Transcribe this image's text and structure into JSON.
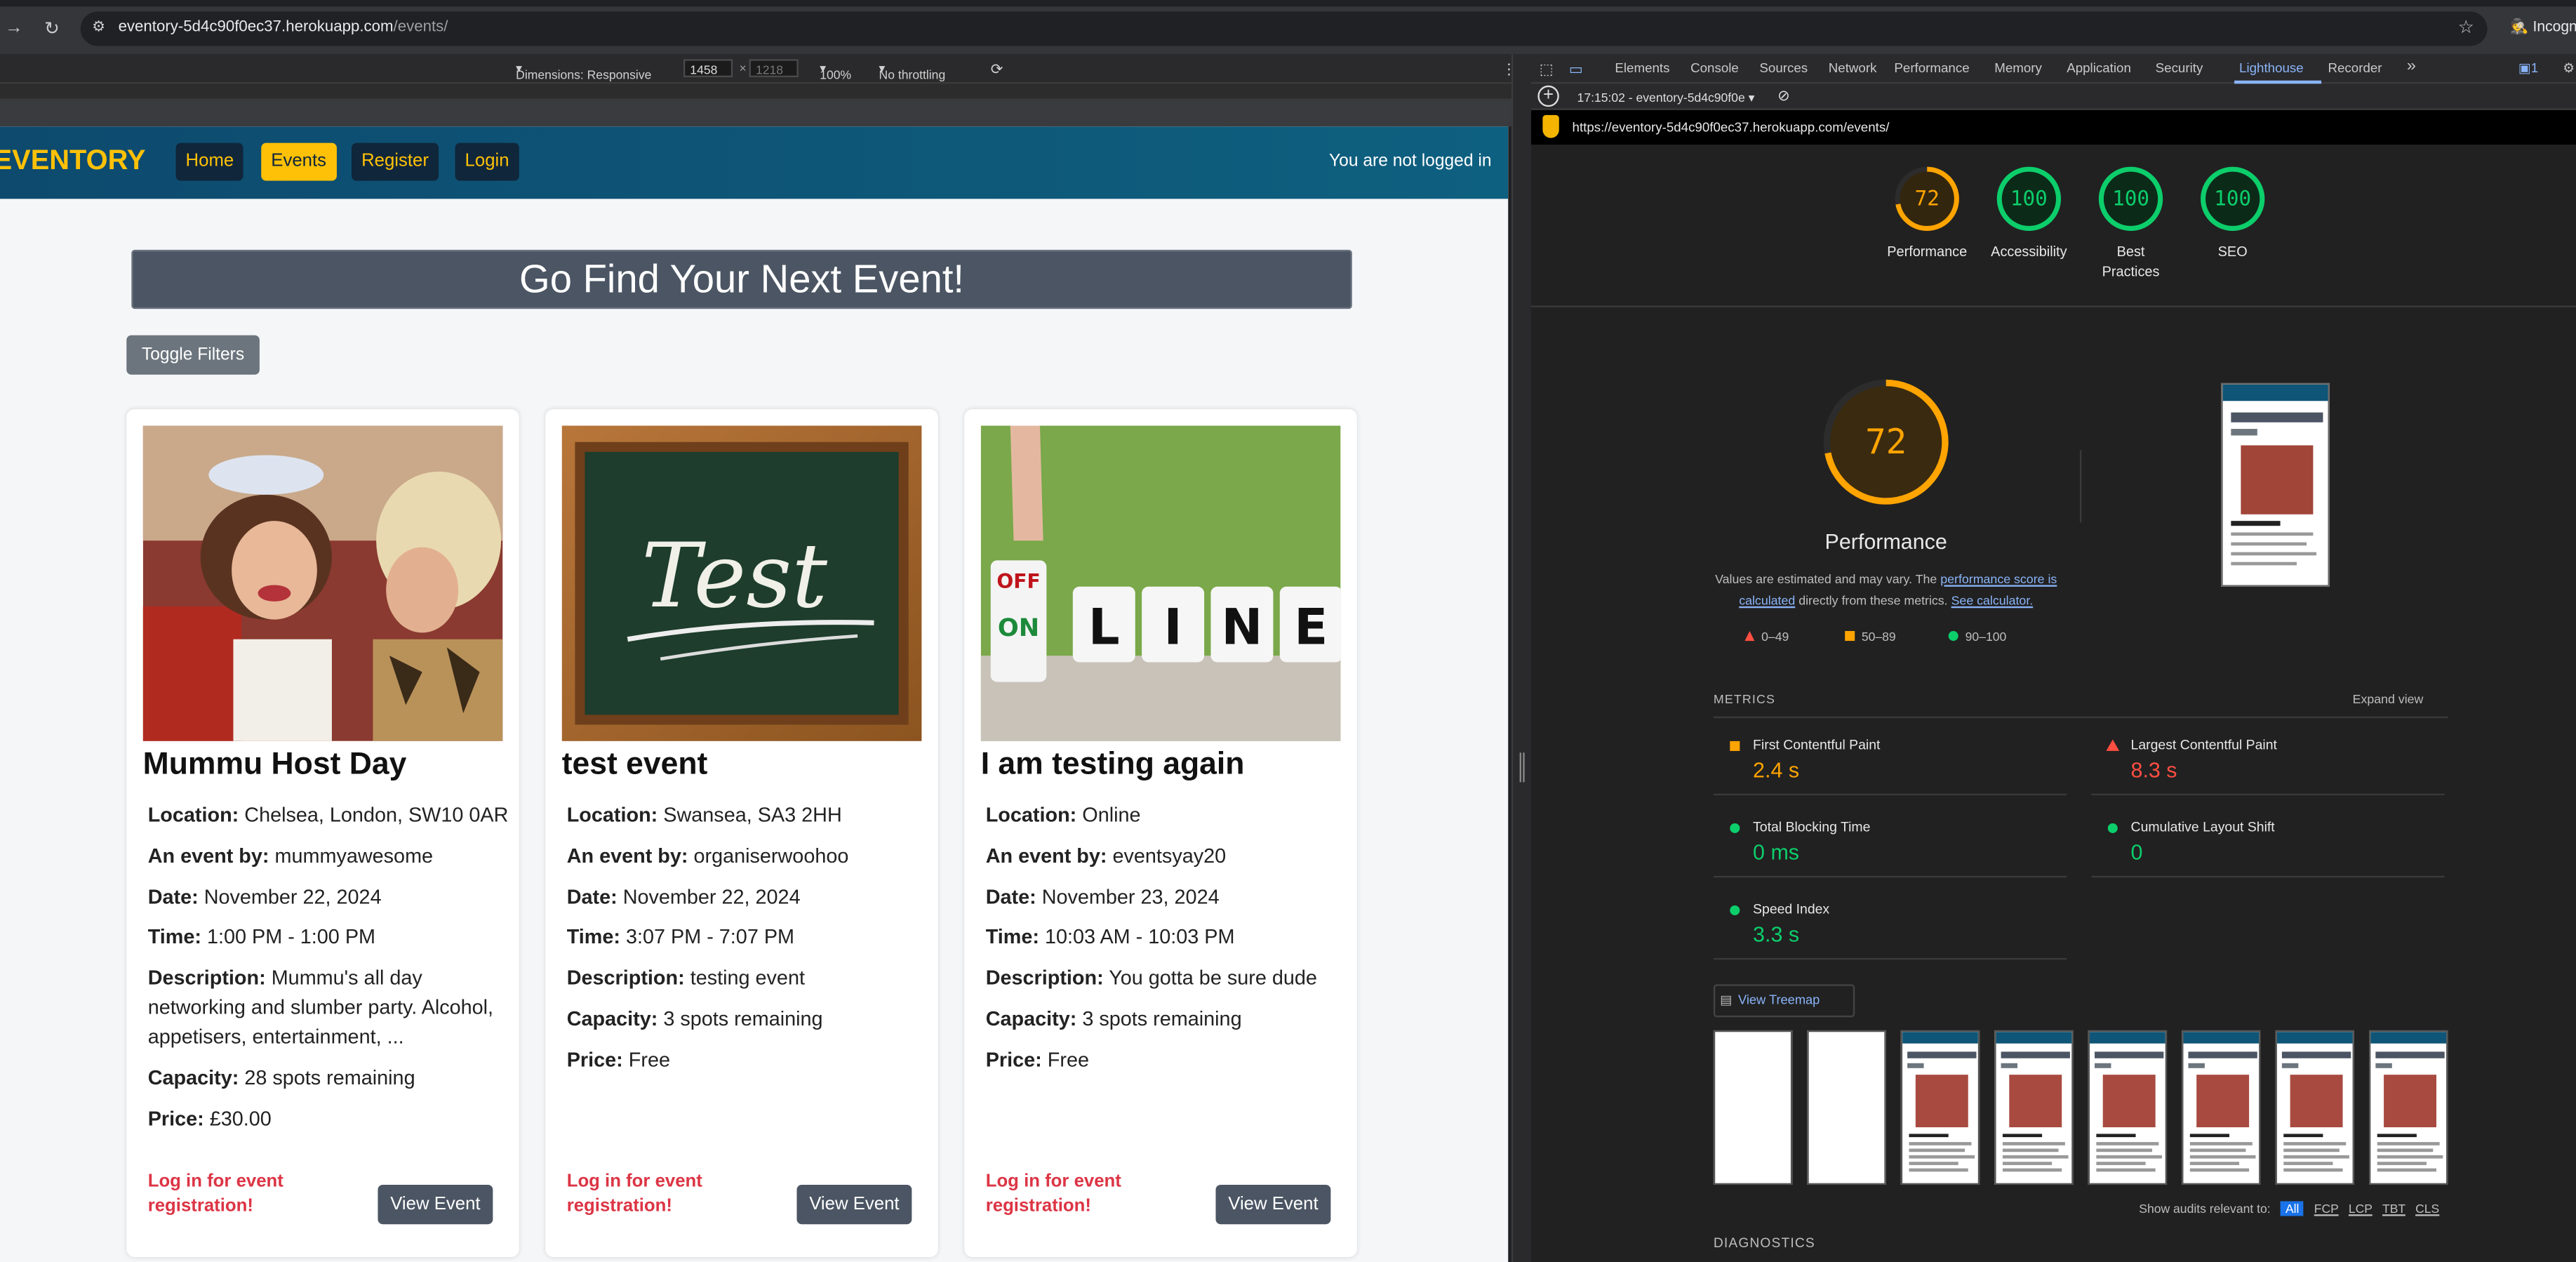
{
  "browser": {
    "url_domain": "eventory-5d4c90f0ec37.herokuapp.com",
    "url_path": "/events/",
    "incognito_label": "Incognito"
  },
  "device_toolbar": {
    "dimensions_label": "Dimensions: Responsive",
    "width": "1458",
    "height": "1218",
    "zoom": "100%",
    "throttling": "No throttling"
  },
  "site": {
    "brand": "EVENTORY",
    "nav": [
      "Home",
      "Events",
      "Register",
      "Login"
    ],
    "active_nav": "Events",
    "login_status": "You are not logged in",
    "hero_title": "Go Find Your Next Event!",
    "toggle_filters": "Toggle Filters",
    "cards": [
      {
        "title": "Mummu Host Day",
        "image": "party-photo",
        "location": "Chelsea, London, SW10 0AR",
        "organiser": "mummyawesome",
        "date": "November 22, 2024",
        "time": "1:00 PM - 1:00 PM",
        "description": "Mummu's all day networking and slumber party. Alcohol, appetisers, entertainment, ...",
        "capacity": "28 spots remaining",
        "price": "£30.00"
      },
      {
        "title": "test event",
        "image": "chalkboard-test",
        "location": "Swansea, SA3 2HH",
        "organiser": "organiserwoohoo",
        "date": "November 22, 2024",
        "time": "3:07 PM - 7:07 PM",
        "description": "testing event",
        "capacity": "3 spots remaining",
        "price": "Free"
      },
      {
        "title": "I am testing again",
        "image": "online-dice",
        "location": "Online",
        "organiser": "eventsyay20",
        "date": "November 23, 2024",
        "time": "10:03 AM - 10:03 PM",
        "description": "You gotta be sure dude",
        "capacity": "3 spots remaining",
        "price": "Free"
      }
    ],
    "labels": {
      "location": "Location:",
      "organiser": "An event by:",
      "date": "Date:",
      "time": "Time:",
      "description": "Description:",
      "capacity": "Capacity:",
      "price": "Price:"
    },
    "login_prompt": "Log in for event registration!",
    "view_event": "View Event",
    "dice_letters": [
      "L",
      "I",
      "N",
      "E"
    ],
    "dice_off": "OFF",
    "dice_on": "ON",
    "chalk_text": "Test"
  },
  "devtools": {
    "tabs": [
      "Elements",
      "Console",
      "Sources",
      "Network",
      "Performance",
      "Memory",
      "Application",
      "Security",
      "Lighthouse",
      "Recorder"
    ],
    "active_tab": "Lighthouse",
    "issues_count": "1",
    "report_selector": "17:15:02 - eventory-5d4c90f0e",
    "report_url": "https://eventory-5d4c90f0ec37.herokuapp.com/events/",
    "scores": [
      {
        "label": "Performance",
        "value": 72,
        "color": "#ffa400"
      },
      {
        "label": "Accessibility",
        "value": 100,
        "color": "#0cce6b"
      },
      {
        "label": "Best Practices",
        "value": 100,
        "color": "#0cce6b"
      },
      {
        "label": "SEO",
        "value": 100,
        "color": "#0cce6b"
      }
    ],
    "perf": {
      "value": "72",
      "title": "Performance",
      "note_a": "Values are estimated and may vary. The ",
      "note_link1": "performance score is calculated",
      "note_b": " directly from these metrics. ",
      "note_link2": "See calculator.",
      "legend": [
        "0–49",
        "50–89",
        "90–100"
      ]
    },
    "metrics_header": "METRICS",
    "expand_view": "Expand view",
    "metrics": [
      {
        "name": "First Contentful Paint",
        "value": "2.4 s",
        "status": "average"
      },
      {
        "name": "Largest Contentful Paint",
        "value": "8.3 s",
        "status": "fail"
      },
      {
        "name": "Total Blocking Time",
        "value": "0 ms",
        "status": "pass"
      },
      {
        "name": "Cumulative Layout Shift",
        "value": "0",
        "status": "pass"
      },
      {
        "name": "Speed Index",
        "value": "3.3 s",
        "status": "pass"
      }
    ],
    "view_treemap": "View Treemap",
    "show_audits": "Show audits relevant to:",
    "audit_filters": [
      "All",
      "FCP",
      "LCP",
      "TBT",
      "CLS"
    ],
    "diagnostics": "DIAGNOSTICS",
    "colors": {
      "pass": "#0cce6b",
      "average": "#ffa400",
      "fail": "#ff4e42"
    }
  }
}
